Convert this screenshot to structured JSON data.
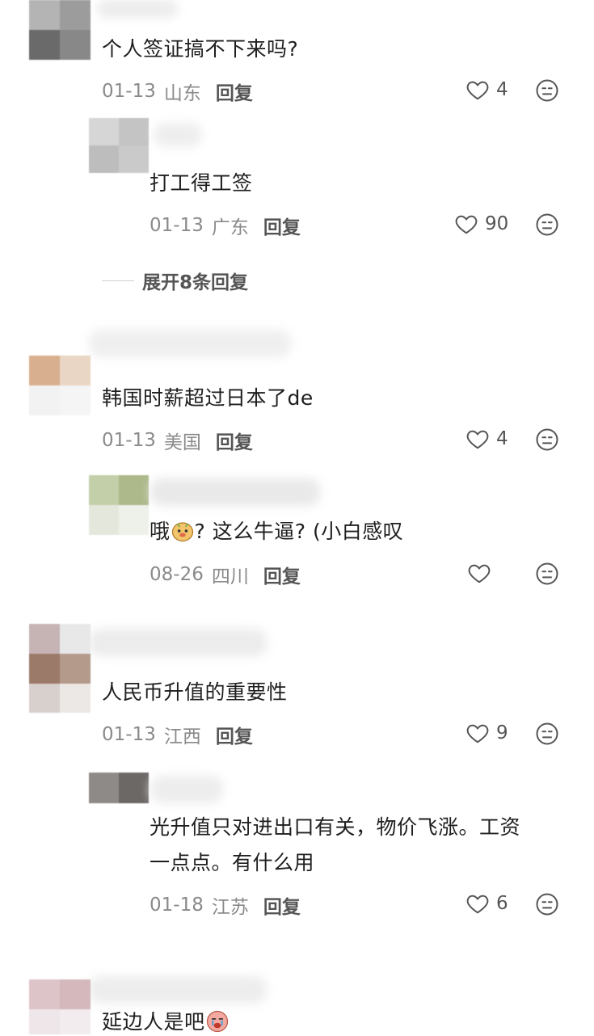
{
  "comments": [
    {
      "text": "个人签证搞不下来吗?",
      "date": "01-13",
      "location": "山东",
      "reply_label": "回复",
      "likes": "4",
      "reply": {
        "text": "打工得工签",
        "date": "01-13",
        "location": "广东",
        "reply_label": "回复",
        "likes": "90"
      },
      "expand_label": "展开8条回复"
    },
    {
      "text": "韩国时薪超过日本了de",
      "date": "01-13",
      "location": "美国",
      "reply_label": "回复",
      "likes": "4",
      "reply": {
        "text_before": "哦",
        "emoji": "doge-emoji",
        "text_after": "? 这么牛逼? (小白感叹",
        "date": "08-26",
        "location": "四川",
        "reply_label": "回复",
        "likes": ""
      }
    },
    {
      "text": "人民币升值的重要性",
      "date": "01-13",
      "location": "江西",
      "reply_label": "回复",
      "likes": "9",
      "reply": {
        "text_line1": "光升值只对进出口有关，物价飞涨。工资",
        "text_line2": "一点点。有什么用",
        "date": "01-18",
        "location": "江苏",
        "reply_label": "回复",
        "likes": "6"
      }
    },
    {
      "text": "延边人是吧",
      "emoji": "crying-face-emoji"
    }
  ],
  "icons": {
    "like": "heart-outline-icon",
    "dislike": "neutral-face-icon"
  },
  "colors": {
    "text": "#1e1e1e",
    "meta": "#8a8a8a",
    "action": "#555555"
  }
}
